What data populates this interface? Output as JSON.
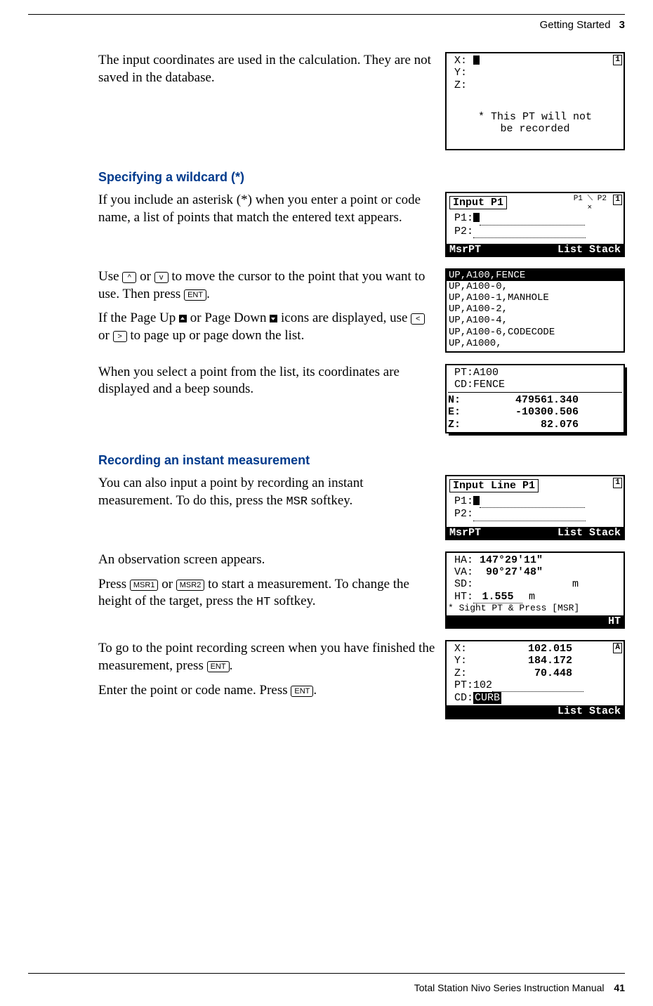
{
  "header": {
    "section": "Getting Started",
    "chapter_no": "3"
  },
  "intro_para": "The input coordinates are used in the calculation. They are not saved in the database.",
  "screen_xyz_blank": {
    "x": "X:",
    "y": "Y:",
    "z": "Z:",
    "note1": "* This PT will not",
    "note2": "be recorded"
  },
  "wildcard": {
    "heading": "Specifying a wildcard (*)",
    "para1": "If you include an asterisk (*) when you enter a point or code name, a list of points that match the entered text appears.",
    "para2a": "Use ",
    "key_up": "^",
    "para2b": " or ",
    "key_dn": "v",
    "para2c": " to move the cursor to the point that you want to use. Then press ",
    "key_ent": "ENT",
    "para2d": ".",
    "para3a": "If the Page Up ",
    "para3b": " or Page Down ",
    "para3c": " icons are displayed, use ",
    "key_left": "<",
    "para3d": " or ",
    "key_right": ">",
    "para3e": " to page up or page down the list.",
    "para4": "When you select a point from the list, its coordinates are displayed and a beep sounds."
  },
  "screen_input_p1": {
    "title": "Input P1",
    "p1": "P1:",
    "p2": "P2:",
    "bar_left": "MsrPT",
    "bar_right": "List Stack"
  },
  "screen_list": {
    "rows": [
      "UP,A100,FENCE",
      "UP,A100-0,",
      "UP,A100-1,MANHOLE",
      "UP,A100-2,",
      "UP,A100-4,",
      "UP,A100-6,CODECODE",
      "UP,A1000,"
    ]
  },
  "screen_pt_detail": {
    "pt": "PT:A100",
    "cd": "CD:FENCE",
    "n_label": "N:",
    "n_val": "479561.340",
    "e_label": "E:",
    "e_val": "-10300.506",
    "z_label": "Z:",
    "z_val": "82.076"
  },
  "record": {
    "heading": "Recording an instant measurement",
    "para1a": "You can also input a point by recording an instant measurement. To do this, press the ",
    "msr": "MSR",
    "para1b": " softkey.",
    "para2": "An observation screen appears.",
    "para3a": "Press ",
    "key_msr1": "MSR1",
    "para3b": " or ",
    "key_msr2": "MSR2",
    "para3c": " to start a measurement. To change the height of the target, press the ",
    "ht": "HT",
    "para3d": " softkey.",
    "para4a": "To go to the point recording screen when you have finished the measurement, press ",
    "key_ent": "ENT",
    "para4b": ".",
    "para5a": "Enter the point or code name. Press ",
    "para5b": "."
  },
  "screen_input_line": {
    "title": "Input Line P1",
    "p1": "P1:",
    "p2": "P2:",
    "bar_left": "MsrPT",
    "bar_right": "List Stack"
  },
  "screen_obs": {
    "ha_l": "HA:",
    "ha_v": "147°29'11\"",
    "va_l": "VA:",
    "va_v": "90°27'48\"",
    "sd_l": "SD:",
    "sd_v": "m",
    "ht_l": "HT:",
    "ht_v": "1.555",
    "ht_u": "m",
    "note": "* Sight PT & Press [MSR]",
    "bar_right": "HT"
  },
  "screen_result": {
    "x_l": "X:",
    "x_v": "102.015",
    "y_l": "Y:",
    "y_v": "184.172",
    "z_l": "Z:",
    "z_v": "70.448",
    "pt": "PT:102",
    "cd_l": "CD:",
    "cd_v": "CURB",
    "bar_right": "List Stack"
  },
  "footer": {
    "title": "Total Station Nivo Series Instruction Manual",
    "page": "41"
  }
}
